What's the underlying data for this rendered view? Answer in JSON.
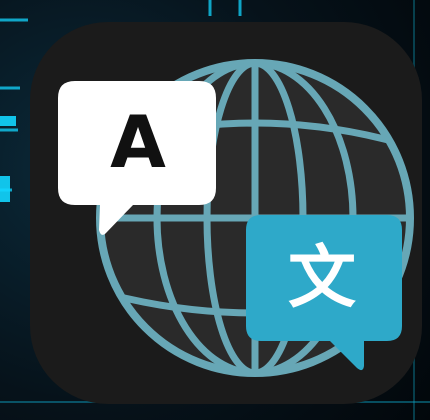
{
  "app_icon": {
    "latin_glyph": "A",
    "cjk_glyph": "文"
  },
  "colors": {
    "icon_background": "#1b1b1b",
    "globe_line": "#67a7b6",
    "globe_fill": "#2a2a2a",
    "left_bubble": "#ffffff",
    "right_bubble": "#2ea9c9",
    "glyph_dark": "#111111",
    "glyph_light": "#ffffff",
    "backdrop_accent": "#13d6ff"
  }
}
